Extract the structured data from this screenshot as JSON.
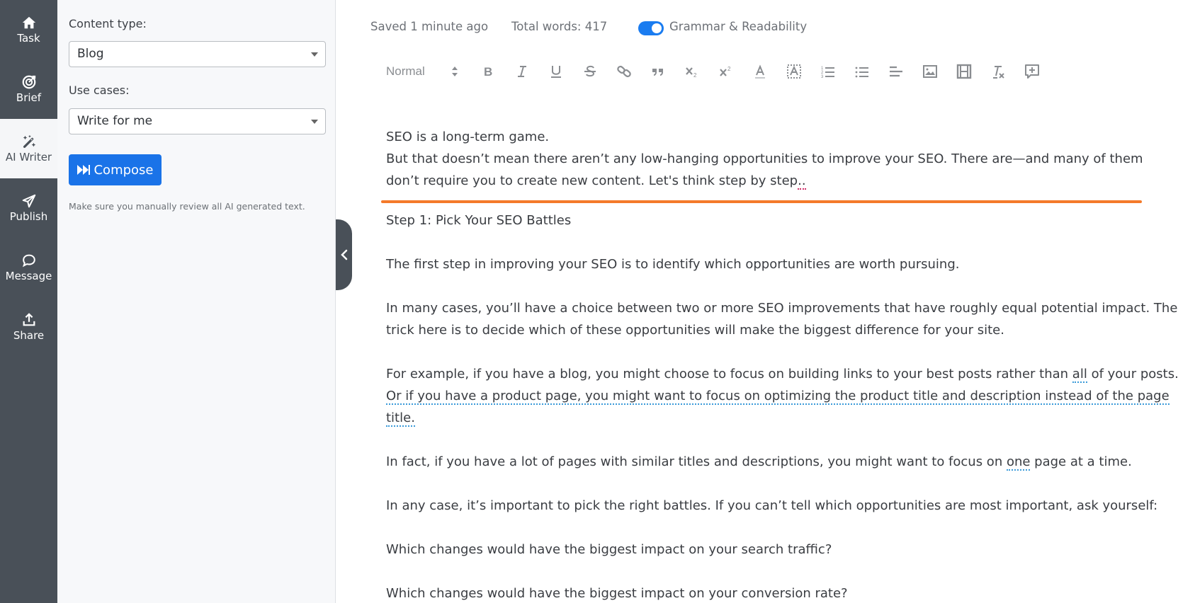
{
  "rail": {
    "items": [
      {
        "label": "Task",
        "icon": "home-icon",
        "active": false
      },
      {
        "label": "Brief",
        "icon": "target-icon",
        "active": false
      },
      {
        "label": "AI Writer",
        "icon": "magic-wand-icon",
        "active": true
      },
      {
        "label": "Publish",
        "icon": "paper-plane-icon",
        "active": false
      },
      {
        "label": "Message",
        "icon": "chat-bubble-icon",
        "active": false
      },
      {
        "label": "Share",
        "icon": "upload-icon",
        "active": false
      }
    ]
  },
  "panel": {
    "content_type_label": "Content type:",
    "content_type_value": "Blog",
    "use_cases_label": "Use cases:",
    "use_cases_value": "Write for me",
    "compose_label": "Compose",
    "hint": "Make sure you manually review all AI generated text."
  },
  "status": {
    "saved": "Saved 1 minute ago",
    "word_count": "Total words: 417",
    "grammar_toggle_label": "Grammar & Readability",
    "grammar_toggle_on": true
  },
  "toolbar": {
    "format_value": "Normal",
    "buttons": [
      "bold",
      "italic",
      "underline",
      "strikethrough",
      "link",
      "blockquote",
      "subscript",
      "superscript",
      "text-color",
      "background-color",
      "ordered-list",
      "bullet-list",
      "align",
      "image",
      "video",
      "clear-formatting",
      "add-comment"
    ]
  },
  "colors": {
    "accent": "#1a73e8",
    "rail_bg": "#495058",
    "divider": "#f47a2a"
  },
  "editor": {
    "intro_1": "SEO is a long-term game.",
    "intro_2": "But that doesn’t mean there aren’t any low-hanging opportunities to improve your SEO. There are—and many of them",
    "intro_3a": "don’t require you to create new content. Let's think step by step",
    "intro_3b": "..",
    "heading": "Step 1: Pick Your SEO Battles",
    "p1": "The first step in improving your SEO is to identify which opportunities are worth pursuing.",
    "p2_1": "In many cases, you’ll have a choice between two or more SEO improvements that have roughly equal potential impact. The",
    "p2_2": "trick here is to decide which of these opportunities will make the biggest difference for your site.",
    "p3_1a": "For example, if you have a blog, you might choose to focus on building links to your best posts rather than ",
    "p3_1b": "all",
    "p3_1c": " of your posts.",
    "p3_2": "Or if you have a product page, you might want to focus on optimizing the product title and description instead of the page",
    "p3_3": "title.",
    "p4a": "In fact, if you have a lot of pages with similar titles and descriptions, you might want to focus on ",
    "p4b": "one",
    "p4c": " page at a time.",
    "p5": "In any case, it’s important to pick the right battles. If you can’t tell which opportunities are most important, ask yourself:",
    "q1": "Which changes would have the biggest impact on your search traffic?",
    "q2": "Which changes would have the biggest impact on your conversion rate?"
  }
}
